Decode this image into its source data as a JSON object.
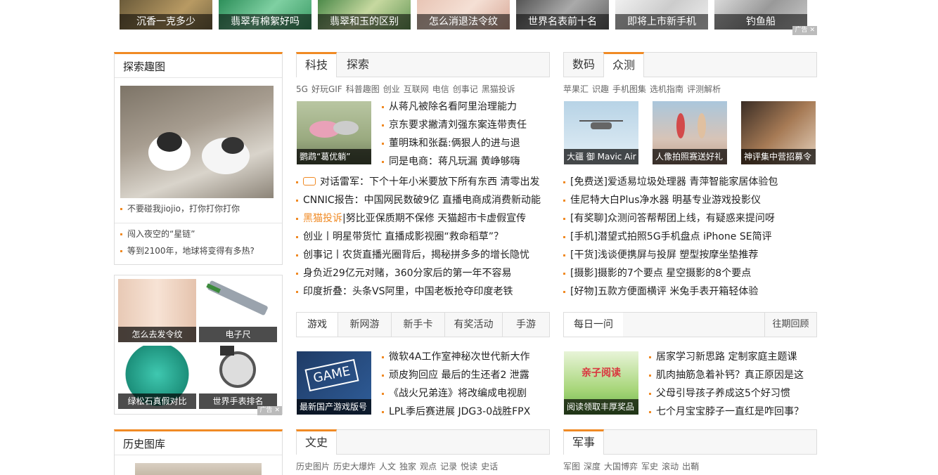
{
  "top_ads": {
    "items": [
      "沉香一克多少",
      "翡翠有棉絮好吗",
      "翡翠和玉的区别",
      "怎么消退法令纹",
      "世界名表前十名",
      "即将上市新手机",
      "钓鱼船"
    ],
    "mark": "广告",
    "close": "✕"
  },
  "explore": {
    "title": "探索趣图",
    "image_caption": "不要碰我jiojio，打你打你打你",
    "links": [
      "闯入夜空的“星链”",
      "等到2100年，地球将变得有多热?"
    ]
  },
  "left_ad": {
    "items": [
      "怎么去发令纹",
      "电子尺",
      "绿松石真假对比",
      "世界手表排名"
    ],
    "mark": "广告",
    "close": "✕"
  },
  "history_gallery": {
    "title": "历史图库"
  },
  "tech": {
    "tabs": [
      "科技",
      "探索"
    ],
    "tags": [
      "5G",
      "好玩GIF",
      "科普趣图",
      "创业",
      "互联网",
      "电信",
      "创事记",
      "黑猫投诉"
    ],
    "image_caption": "鹦鹉“葛优躺”",
    "side_news": [
      "从蒋凡被除名看阿里治理能力",
      "京东要求撇清刘强东案连带责任",
      "董明珠和张磊:俩狠人的进与退",
      "同是电商：蒋凡玩漏 黄峥够嗨"
    ],
    "news": [
      "对话雷军：下个十年小米要放下所有东西 清零出发",
      "CNNIC报告：中国网民数破9亿 直播电商成消费新动能",
      "黑猫投诉|努比亚保质期不保修 天猫超市卡虚假宣传",
      "创业丨明星带货忙 直播成影视圈“救命稻草”？",
      "创事记丨农货直播光圈背后，揭秘拼多多的增长隐忧",
      "身负近29亿元对赌，360分家后的第一年不容易",
      "印度折叠：头条VS阿里，中国老板抢夺印度老铁"
    ],
    "news_highlight": "黑猫投诉"
  },
  "games": {
    "tabs": [
      "游戏",
      "新网游",
      "新手卡",
      "有奖活动",
      "手游"
    ],
    "image_caption": "最新国产游戏版号",
    "image_text": "GAME",
    "news": [
      "微软4A工作室神秘次世代新大作",
      "顽皮狗回应 最后的生还者2 泄露",
      "《战火兄弟连》将改编成电视剧",
      "LPL季后赛进展 JDG3-0战胜FPX"
    ]
  },
  "culture": {
    "tabs": [
      "文史"
    ],
    "tags": [
      "历史图片",
      "历史大爆炸",
      "人文",
      "独家",
      "观点",
      "记录",
      "悦读",
      "史话"
    ]
  },
  "digital": {
    "tabs": [
      "数码",
      "众测"
    ],
    "tags": [
      "苹果汇",
      "识趣",
      "手机图集",
      "选机指南",
      "评测解析"
    ],
    "thumbs": [
      "大疆 御 Mavic Air",
      "人像拍照赛送好礼",
      "神评集中营招募令"
    ],
    "news": [
      "[免费送]爱适易垃圾处理器 青萍智能家居体验包",
      "佳尼特大白Plus净水器 明基专业游戏投影仪",
      "[有奖聊]众测问答帮帮团上线，有疑惑来提问呀",
      "[手机]潜望式拍照5G手机盘点 iPhone SE简评",
      "[干货]浅谈便携屏与投屏 塑型按摩坐垫推荐",
      "[摄影]摄影的7个要点 星空摄影的8个要点",
      "[好物]五款方便面横评 米兔手表开箱轻体验"
    ]
  },
  "daily": {
    "tab": "每日一问",
    "past": "往期回顾",
    "image_caption": "阅读领取丰厚奖品",
    "image_text": "亲子阅读",
    "news": [
      "居家学习新思路 定制家庭主题课",
      "肌肉抽筋急着补钙？真正原因是这",
      "父母引导孩子养成这5个好习惯",
      "七个月宝宝脖子一直红是咋回事？"
    ]
  },
  "military": {
    "tabs": [
      "军事"
    ],
    "tags": [
      "军图",
      "深度",
      "大国博弈",
      "军史",
      "滚动",
      "出鞘"
    ]
  },
  "colors": {
    "accent": "#f08a24"
  }
}
